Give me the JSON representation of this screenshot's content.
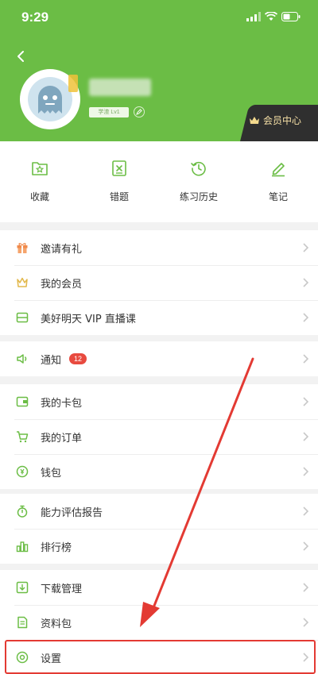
{
  "status_bar": {
    "time": "9:29"
  },
  "profile": {
    "level": "学渣 Lv1",
    "vip_center_label": "会员中心"
  },
  "shortcuts": [
    {
      "label": "收藏",
      "icon": "star-folder-icon"
    },
    {
      "label": "错题",
      "icon": "wrong-question-icon"
    },
    {
      "label": "练习历史",
      "icon": "history-icon"
    },
    {
      "label": "笔记",
      "icon": "pen-icon"
    }
  ],
  "groups": [
    {
      "items": [
        {
          "label": "邀请有礼",
          "icon": "gift-icon"
        },
        {
          "label": "我的会员",
          "icon": "crown-icon"
        },
        {
          "label": "美好明天 VIP 直播课",
          "icon": "live-class-icon"
        }
      ]
    },
    {
      "items": [
        {
          "label": "通知",
          "icon": "speaker-icon",
          "badge": "12"
        }
      ]
    },
    {
      "items": [
        {
          "label": "我的卡包",
          "icon": "card-wallet-icon"
        },
        {
          "label": "我的订单",
          "icon": "cart-icon"
        },
        {
          "label": "钱包",
          "icon": "wallet-coin-icon"
        }
      ]
    },
    {
      "items": [
        {
          "label": "能力评估报告",
          "icon": "stopwatch-icon"
        },
        {
          "label": "排行榜",
          "icon": "bar-chart-icon"
        }
      ]
    },
    {
      "items": [
        {
          "label": "下载管理",
          "icon": "download-icon"
        },
        {
          "label": "资料包",
          "icon": "document-pack-icon"
        },
        {
          "label": "设置",
          "icon": "settings-icon"
        }
      ]
    }
  ],
  "colors": {
    "header_green": "#6bbd45",
    "accent_green": "#6bbd45",
    "badge_red": "#e84a3f",
    "highlight_red": "#e33a33"
  }
}
